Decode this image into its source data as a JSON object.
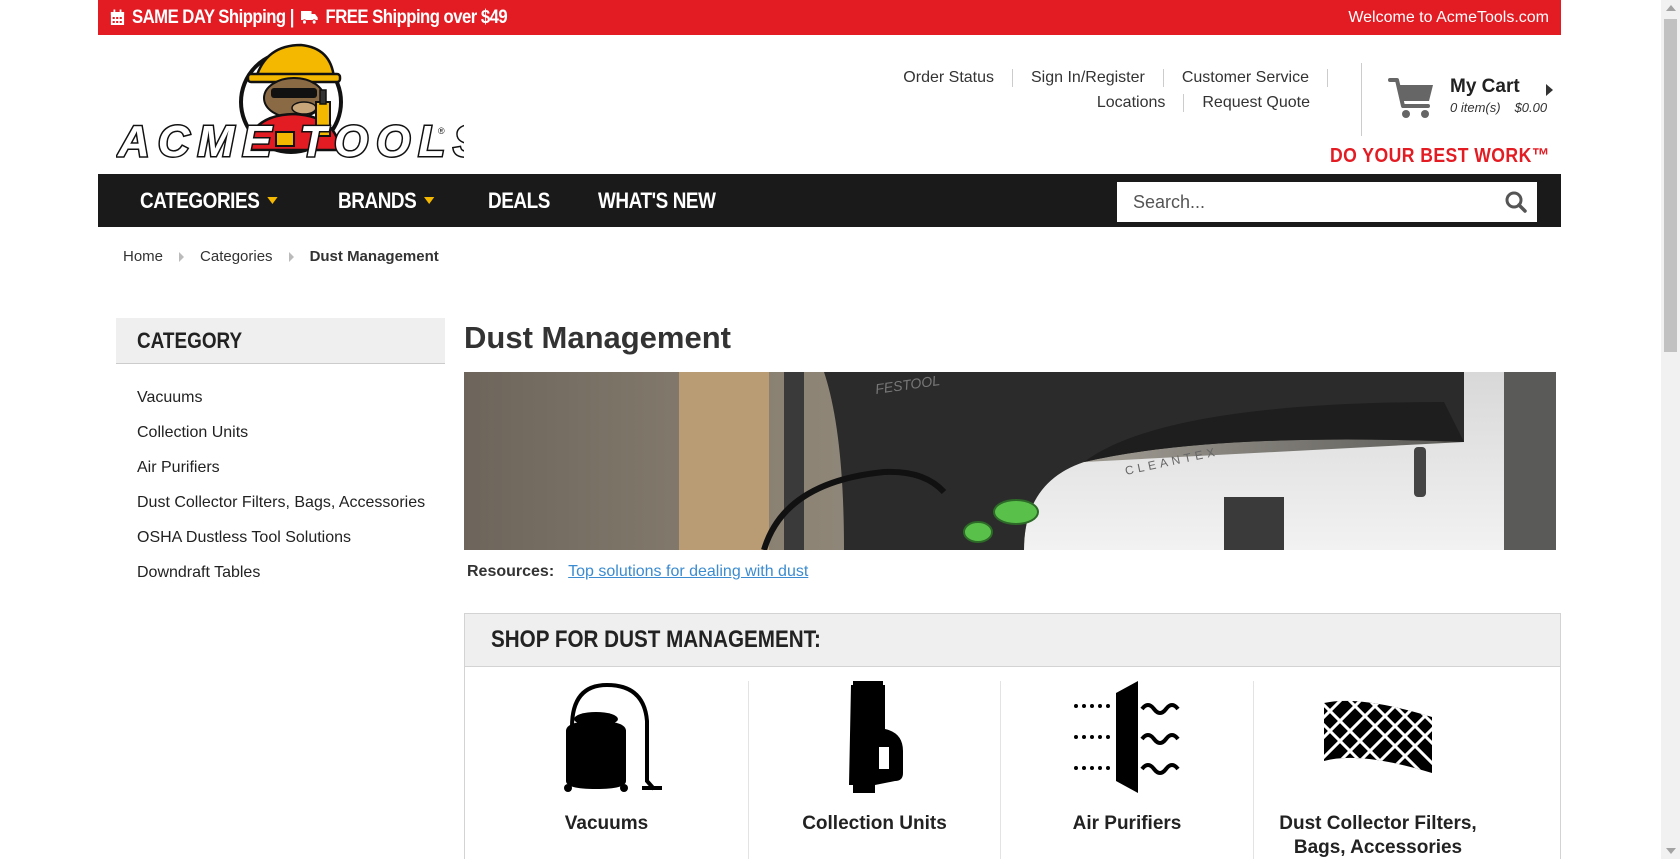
{
  "promo": {
    "left_text": "SAME DAY Shipping | ",
    "free_text": "FREE Shipping over $49",
    "welcome": "Welcome to AcmeTools.com",
    "calendar_icon": "calendar-icon",
    "truck_icon": "truck-icon"
  },
  "brand": {
    "logo_text": "ACME TOOLS",
    "tagline": "DO YOUR BEST WORK™",
    "accent_red": "#e31b23",
    "accent_yellow": "#f5b800"
  },
  "toplinks": {
    "order_status": "Order Status",
    "sign_in": "Sign In/Register",
    "customer_service": "Customer Service",
    "locations": "Locations",
    "request_quote": "Request Quote"
  },
  "cart": {
    "title": "My Cart",
    "items": "0 item(s)",
    "total": "$0.00"
  },
  "nav": {
    "items": [
      {
        "label": "CATEGORIES",
        "has_dropdown": true
      },
      {
        "label": "BRANDS",
        "has_dropdown": true
      },
      {
        "label": "DEALS",
        "has_dropdown": false
      },
      {
        "label": "WHAT'S NEW",
        "has_dropdown": false
      }
    ],
    "search_placeholder": "Search..."
  },
  "breadcrumb": {
    "home": "Home",
    "categories": "Categories",
    "current": "Dust Management"
  },
  "sidebar": {
    "heading": "CATEGORY",
    "items": [
      "Vacuums",
      "Collection Units",
      "Air Purifiers",
      "Dust Collector Filters, Bags, Accessories",
      "OSHA Dustless Tool Solutions",
      "Downdraft Tables"
    ]
  },
  "main": {
    "title": "Dust Management",
    "banner_brand": "FESTOOL",
    "banner_model": "CLEANTEX",
    "resources_label": "Resources:",
    "resources_link": "Top solutions for dealing with dust",
    "shop_heading": "SHOP FOR DUST MANAGEMENT:",
    "tiles": [
      {
        "label": "Vacuums",
        "icon": "vacuum-icon"
      },
      {
        "label": "Collection Units",
        "icon": "collection-unit-icon"
      },
      {
        "label": "Air Purifiers",
        "icon": "air-purifier-icon"
      },
      {
        "label": "Dust Collector Filters, Bags, Accessories",
        "icon": "filter-icon"
      }
    ]
  }
}
